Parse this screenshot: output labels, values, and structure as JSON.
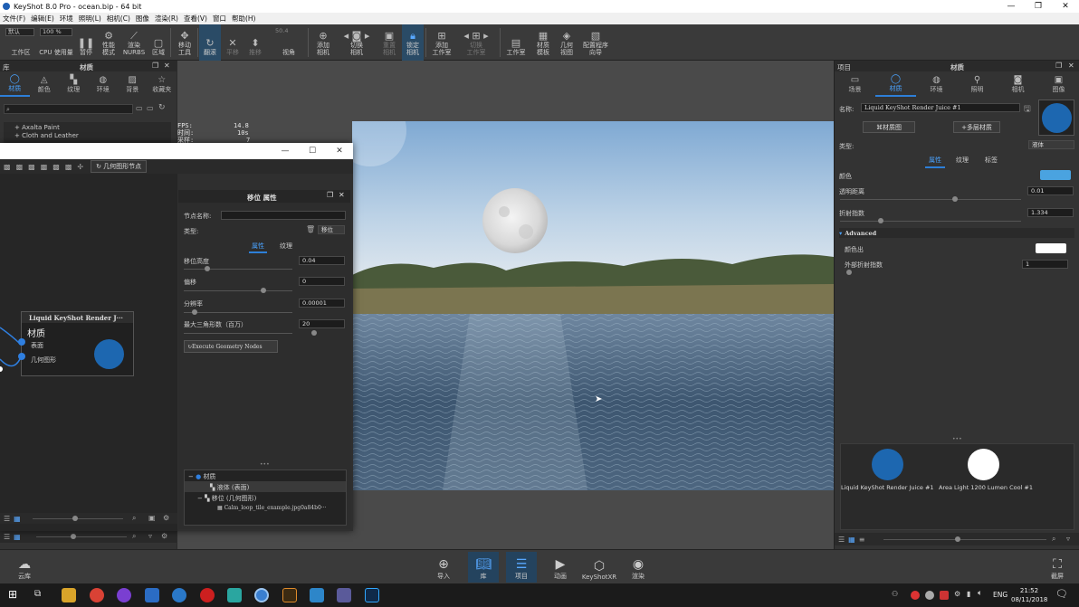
{
  "titlebar": {
    "title": "KeyShot 8.0 Pro  -  ocean.bip  -  64 bit",
    "minimize": "—",
    "maximize": "❐",
    "close": "✕"
  },
  "menubar": {
    "items": [
      "文件(F)",
      "编辑(E)",
      "环境",
      "照明(L)",
      "相机(C)",
      "图像",
      "渲染(R)",
      "查看(V)",
      "窗口",
      "帮助(H)"
    ]
  },
  "ribbon": {
    "preset_value": "默认",
    "zoom_value": "100 %",
    "buttons": {
      "workspace": "工作区",
      "cpu": "CPU 使用量",
      "pause": "暂停",
      "perf": "性能\n模式",
      "render_nurbs": "渲染\nNURBS",
      "region": "区域",
      "move_tool": "移动\n工具",
      "tumble": "翻滚",
      "pan": "平移",
      "dolly": "推移",
      "fov_value": "50.4",
      "view": "视角",
      "add_camera": "添加\n相机",
      "switch_camera": "切换\n相机",
      "reset_camera": "重置\n相机",
      "lock_camera": "锁定\n相机",
      "add_studio": "添加\n工作室",
      "switch_studio": "切换\n工作室",
      "studio": "工作室",
      "material_template": "材质\n模板",
      "geometry_view": "几何\n视图",
      "config_wizard": "配置程序\n向导"
    }
  },
  "left_panel": {
    "header_left": "库",
    "header_title": "材质",
    "tabs": [
      "材质",
      "颜色",
      "纹理",
      "环境",
      "背景",
      "收藏夹"
    ],
    "search_placeholder": "",
    "tree": [
      "Axalta Paint",
      "Cloth and Leather"
    ]
  },
  "dialog": {
    "toolbar_button": "几何图形节点",
    "node": {
      "title": "Liquid KeyShot Render J···",
      "heading": "材质",
      "port1": "表面",
      "port2": "几何图形"
    },
    "props": {
      "title": "移位 属性",
      "node_name_label": "节点名称:",
      "node_name_value": "",
      "type_label": "类型:",
      "type_value": "移位",
      "tab_attr": "属性",
      "tab_tex": "纹理",
      "height_label": "移位高度",
      "height_value": "0.04",
      "offset_label": "偏移",
      "offset_value": "0",
      "resolution_label": "分辨率",
      "resolution_value": "0.00001",
      "max_tri_label": "最大三角形数（百万）",
      "max_tri_value": "20",
      "execute_button": "Execute Geometry Nodes",
      "handle": "•••",
      "tree": [
        "材质",
        "液体 (表面)",
        "移位 (几何图形)",
        "Calm_loop_tile_example.jpg0a84b0···"
      ]
    }
  },
  "viewport": {
    "hud": {
      "fps_label": "FPS:",
      "fps_value": "14.8",
      "time_label": "时间:",
      "time_value": "10s",
      "samples_label": "采样:",
      "samples_value": "7"
    }
  },
  "right_panel": {
    "header_left": "项目",
    "header_title": "材质",
    "tabs": [
      "场景",
      "材质",
      "环境",
      "照明",
      "相机",
      "图像"
    ],
    "name_label": "名称:",
    "name_value": "Liquid KeyShot Render Juice #1",
    "material_graph_button": "材质图",
    "multi_material_button": "多层材质",
    "type_label": "类型:",
    "type_value": "液体",
    "sub_tabs": [
      "属性",
      "纹理",
      "标签"
    ],
    "color_label": "颜色",
    "color_swatch": "#4aa3e0",
    "transparency_label": "透明距离",
    "transparency_value": "0.01",
    "ior_label": "折射指数",
    "ior_value": "1.334",
    "advanced_label": "Advanced",
    "color_out_label": "颜色出",
    "outside_ior_label": "外部折射指数",
    "outside_ior_value": "1",
    "handle": "•••",
    "thumbnails": [
      {
        "label": "Liquid KeyShot Render Juice #1",
        "color": "#1d67b0"
      },
      {
        "label": "Area Light 1200 Lumen Cool #1",
        "color": "#ffffff"
      }
    ]
  },
  "bottombar": {
    "cloud": "云库",
    "items": [
      "导入",
      "库",
      "项目",
      "动画",
      "KeyShotXR",
      "渲染"
    ],
    "screenshot": "截屏"
  },
  "taskbar": {
    "lang": "ENG",
    "time": "21:52",
    "date": "08/11/2018"
  },
  "colors": {
    "accent": "#2d7fd8",
    "material_blue": "#1d67b0"
  }
}
